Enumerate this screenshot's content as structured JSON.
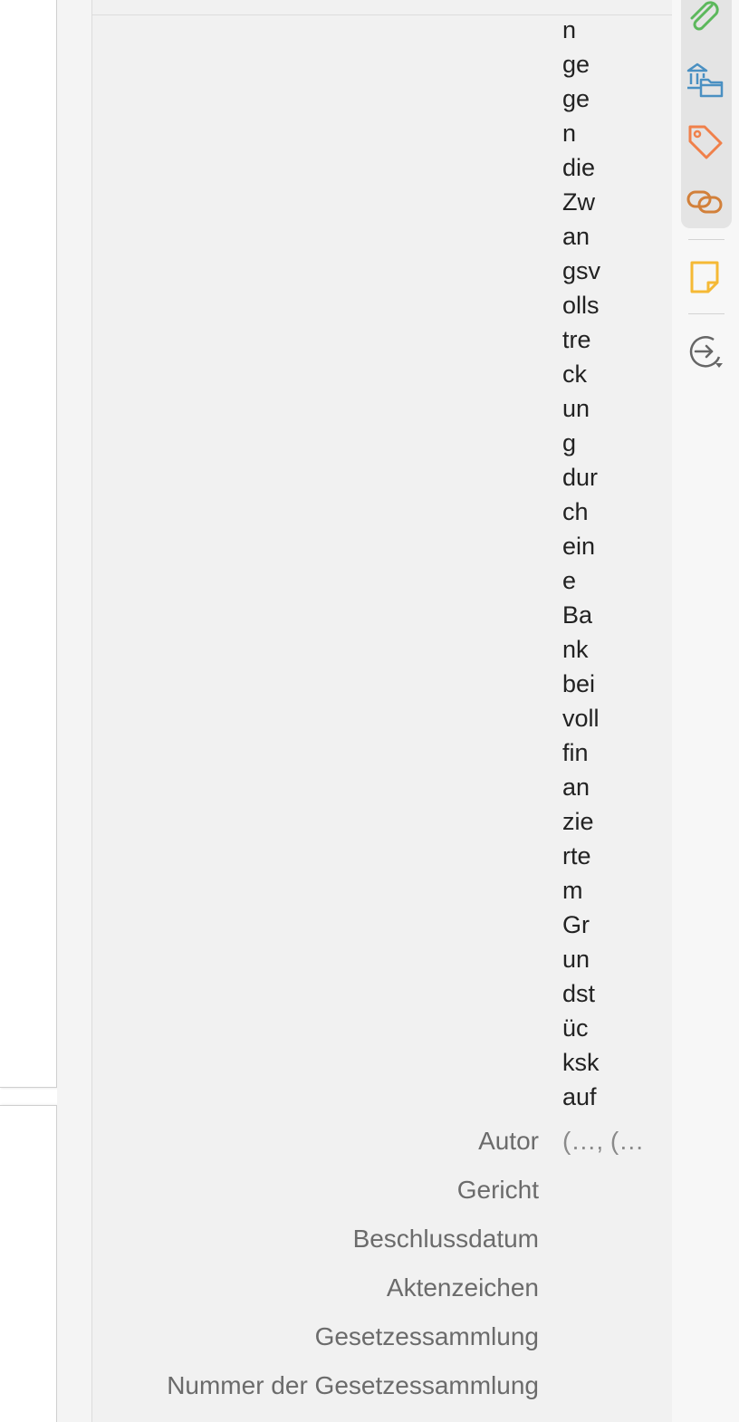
{
  "item": {
    "title_lines": [
      "n",
      "ge",
      "ge",
      "n",
      "die",
      "Zw",
      "an",
      "gsv",
      "olls",
      "tre",
      "ck",
      "un",
      "g",
      "dur",
      "ch",
      "ein",
      "e",
      "Ba",
      "nk",
      "bei",
      "voll",
      "fin",
      "an",
      "zie",
      "rte",
      "m",
      "Gr",
      "un",
      "dst",
      "üc",
      "ksk",
      "auf"
    ],
    "fields": {
      "autor": {
        "label": "Autor",
        "value": "(…, (…"
      },
      "gericht": {
        "label": "Gericht",
        "value": ""
      },
      "beschlussdatum": {
        "label": "Beschlussdatum",
        "value": ""
      },
      "aktenzeichen": {
        "label": "Aktenzeichen",
        "value": ""
      },
      "gesetzessammlung": {
        "label": "Gesetzessammlung",
        "value": ""
      },
      "nummer": {
        "label": "Nummer der Gesetzessammlung",
        "value": ""
      }
    }
  },
  "sidenav": {
    "icons": [
      "attachment-icon",
      "libraries-collections-icon",
      "tag-icon",
      "related-icon",
      "note-icon",
      "locate-icon"
    ],
    "colors": {
      "attachment": "#5cb85c",
      "libraries": "#4a90c2",
      "tag": "#f0804a",
      "related": "#d2803a",
      "note": "#f5b935",
      "locate": "#666666"
    }
  }
}
